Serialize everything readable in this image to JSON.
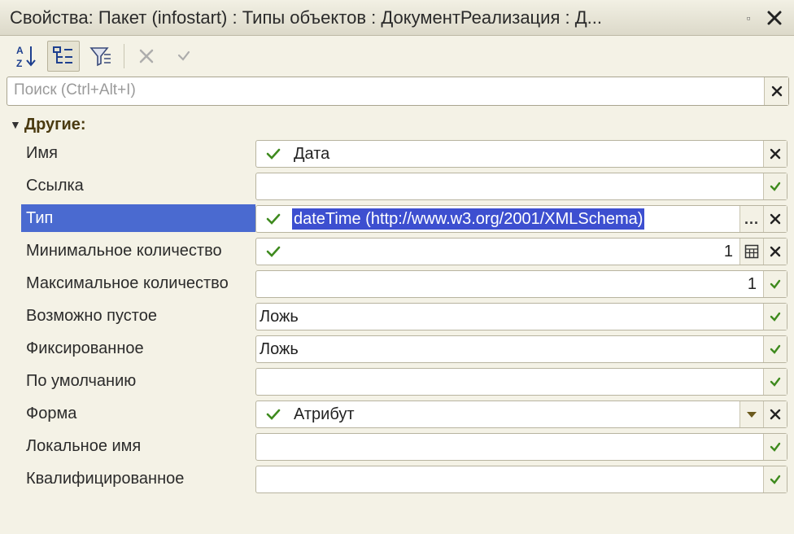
{
  "window": {
    "title": "Свойства: Пакет (infostart) : Типы объектов : ДокументРеализация : Д...",
    "minimize_label": "▫",
    "close_label": "✕"
  },
  "toolbar": {
    "buttons": [
      {
        "name": "sort-az-button",
        "icon": "sort-az-icon"
      },
      {
        "name": "categories-button",
        "icon": "categories-icon",
        "pressed": true
      },
      {
        "name": "filter-button",
        "icon": "filter-icon"
      },
      {
        "name": "cancel-button",
        "icon": "cross-icon"
      },
      {
        "name": "apply-button",
        "icon": "check-icon"
      }
    ]
  },
  "search": {
    "placeholder": "Поиск (Ctrl+Alt+I)"
  },
  "group": {
    "label": "Другие:",
    "expanded": true
  },
  "properties": [
    {
      "label": "Имя",
      "value": "Дата",
      "check": true,
      "buttons": [
        "clear"
      ]
    },
    {
      "label": "Ссылка",
      "value": "",
      "check": false,
      "buttons": [
        "check"
      ]
    },
    {
      "label": "Тип",
      "value": "dateTime (http://www.w3.org/2001/XMLSchema)",
      "check": true,
      "selected": true,
      "buttons": [
        "ellipsis",
        "clear"
      ]
    },
    {
      "label": "Минимальное количество",
      "value": "1",
      "check": true,
      "buttons": [
        "calculator",
        "clear"
      ]
    },
    {
      "label": "Максимальное количество",
      "value": "1",
      "check": false,
      "buttons": [
        "check"
      ]
    },
    {
      "label": "Возможно пустое",
      "value": "Ложь",
      "check": false,
      "buttons": [
        "check"
      ]
    },
    {
      "label": "Фиксированное",
      "value": "Ложь",
      "check": false,
      "buttons": [
        "check"
      ]
    },
    {
      "label": "По умолчанию",
      "value": "",
      "check": false,
      "buttons": [
        "check"
      ]
    },
    {
      "label": "Форма",
      "value": "Атрибут",
      "check": true,
      "buttons": [
        "dropdown",
        "clear"
      ]
    },
    {
      "label": "Локальное имя",
      "value": "",
      "check": false,
      "buttons": [
        "check"
      ]
    },
    {
      "label": "Квалифицированное",
      "value": "",
      "check": false,
      "buttons": [
        "check"
      ]
    }
  ],
  "colors": {
    "selection": "#4a6ad0",
    "check_green": "#3e8a1e",
    "background": "#f4f2e6"
  }
}
